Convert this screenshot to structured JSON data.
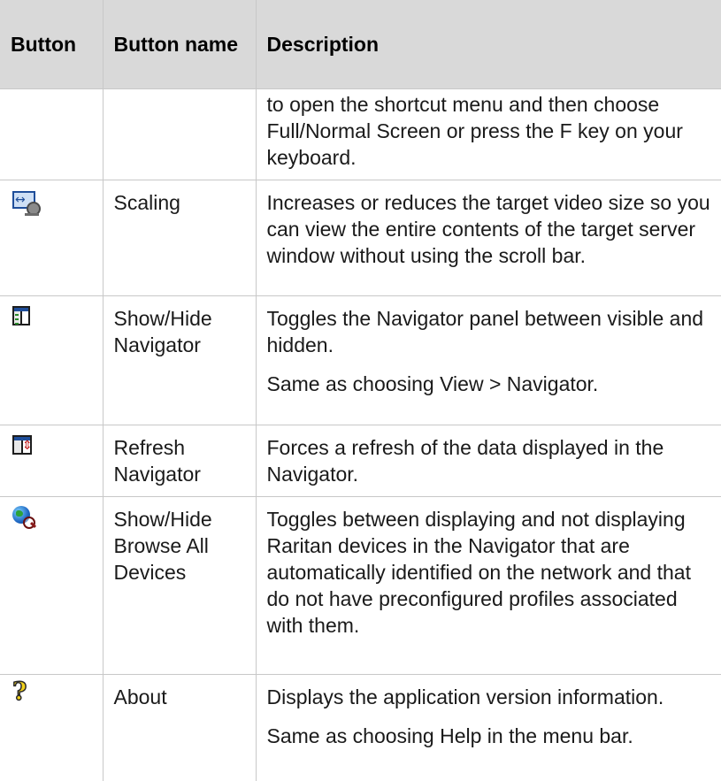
{
  "table": {
    "headers": {
      "button": "Button",
      "button_name": "Button name",
      "description": "Description"
    },
    "continued_row": {
      "description": "to open the shortcut menu and then choose Full/Normal Screen or press the F key on your keyboard."
    },
    "rows": [
      {
        "icon": "scaling-icon",
        "name": "Scaling",
        "description": [
          "Increases or reduces the target video size so you can view the entire contents of the target server window without using the scroll bar."
        ]
      },
      {
        "icon": "navigator-panel-icon",
        "name": "Show/Hide Navigator",
        "description": [
          "Toggles the Navigator panel between visible and hidden.",
          "Same as choosing View > Navigator."
        ]
      },
      {
        "icon": "refresh-navigator-icon",
        "name": "Refresh Navigator",
        "description": [
          "Forces a refresh of the data displayed in the Navigator."
        ]
      },
      {
        "icon": "browse-globe-icon",
        "name": "Show/Hide Browse All Devices",
        "description": [
          "Toggles between displaying and not displaying Raritan devices in the Navigator that are automatically identified on the network and that do not have preconfigured profiles associated with them."
        ]
      },
      {
        "icon": "question-mark-icon",
        "name": "About",
        "description": [
          "Displays the application version information.",
          "Same as choosing Help in the menu bar."
        ]
      }
    ]
  },
  "colors": {
    "header_bg": "#d9d9d9",
    "border": "#c8c8c8"
  }
}
